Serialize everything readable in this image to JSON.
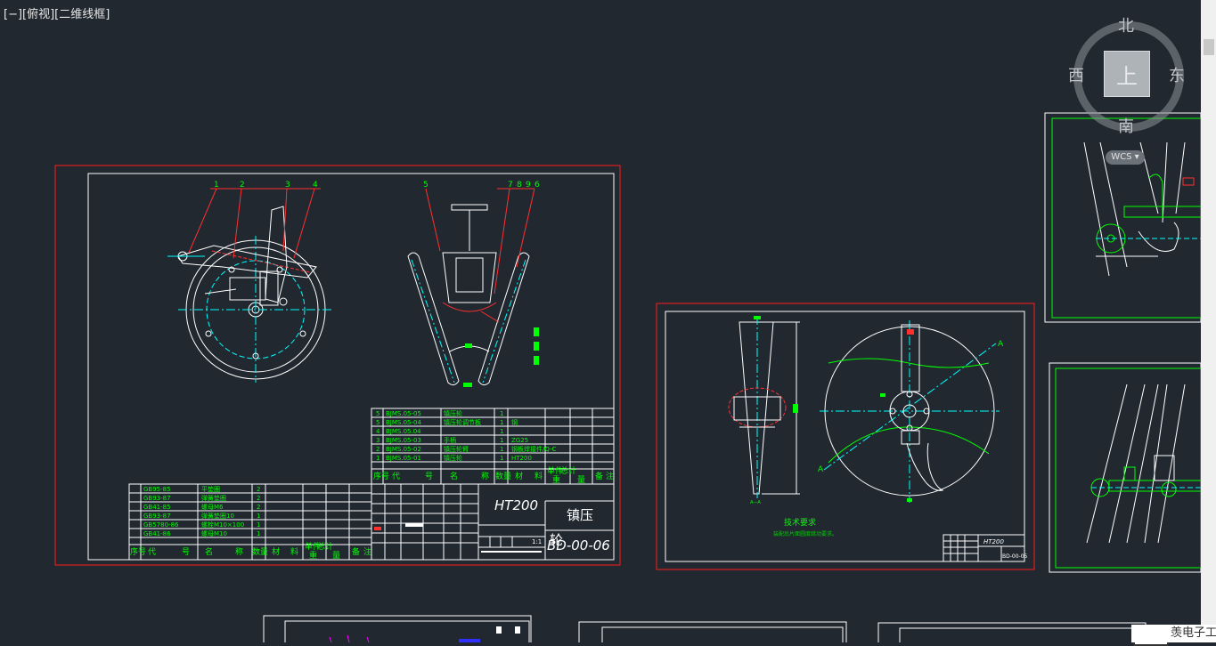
{
  "viewport": {
    "label": "[−][俯视][二维线框]"
  },
  "viewcube": {
    "north": "北",
    "south": "南",
    "west": "西",
    "east": "东",
    "face": "上",
    "wcs": "WCS"
  },
  "sheet_main": {
    "part_no_lines": [
      "5",
      "6",
      "1",
      "4"
    ],
    "bom_top": [
      [
        "5",
        "BJMS.05-05",
        "镇压轮",
        "1",
        ""
      ],
      [
        "5",
        "BJMS.05-04",
        "镇压轮调节板",
        "1",
        "钢"
      ],
      [
        "4",
        "BJMS.05.04",
        "",
        "1",
        ""
      ],
      [
        "3",
        "BJMS.05-03",
        "手柄",
        "1",
        "ZG25"
      ],
      [
        "2",
        "BJMS.05-02",
        "镇压轮臂",
        "1",
        "钢板焊接件/Q-C"
      ],
      [
        "1",
        "BJMS.05-01",
        "镇压轮",
        "1",
        "HT200"
      ]
    ],
    "bom_bottom": [
      [
        "",
        "GB95-85",
        "平垫圈",
        "2",
        ""
      ],
      [
        "",
        "GB93-87",
        "弹簧垫圈",
        "2",
        ""
      ],
      [
        "",
        "GB41-85",
        "螺母M6",
        "2",
        ""
      ],
      [
        "",
        "GB93-87",
        "弹簧垫圈10",
        "1",
        ""
      ],
      [
        "",
        "GB5780-86",
        "螺栓M10×100",
        "1",
        ""
      ],
      [
        "",
        "GB41-86",
        "螺母M10",
        "1",
        ""
      ]
    ],
    "header_cols": [
      "序号",
      "代",
      "号",
      "名",
      "称",
      "数量",
      "材",
      "料",
      "单件",
      "总计",
      "重",
      "量",
      "备",
      "注"
    ],
    "material": "HT200",
    "title_name": "镇压",
    "title_sub": "轮",
    "drawing_no": "BD-00-06",
    "scale": "1:1"
  },
  "sheet_disc": {
    "tech_title": "技术要求",
    "tech_note": "装配后片面圆度跳动要求。",
    "section_label": "A—A",
    "cut_label_a": "A",
    "material": "HT200",
    "drawing_no": "BD-00-05"
  },
  "watermark": {
    "text": "羡电子工"
  },
  "colors": {
    "background": "#212830",
    "frame_red": "#ff1c1c",
    "border_white": "#ffffff",
    "green": "#00ff00",
    "cyan": "#00ffff",
    "red_line": "#ff3030"
  }
}
